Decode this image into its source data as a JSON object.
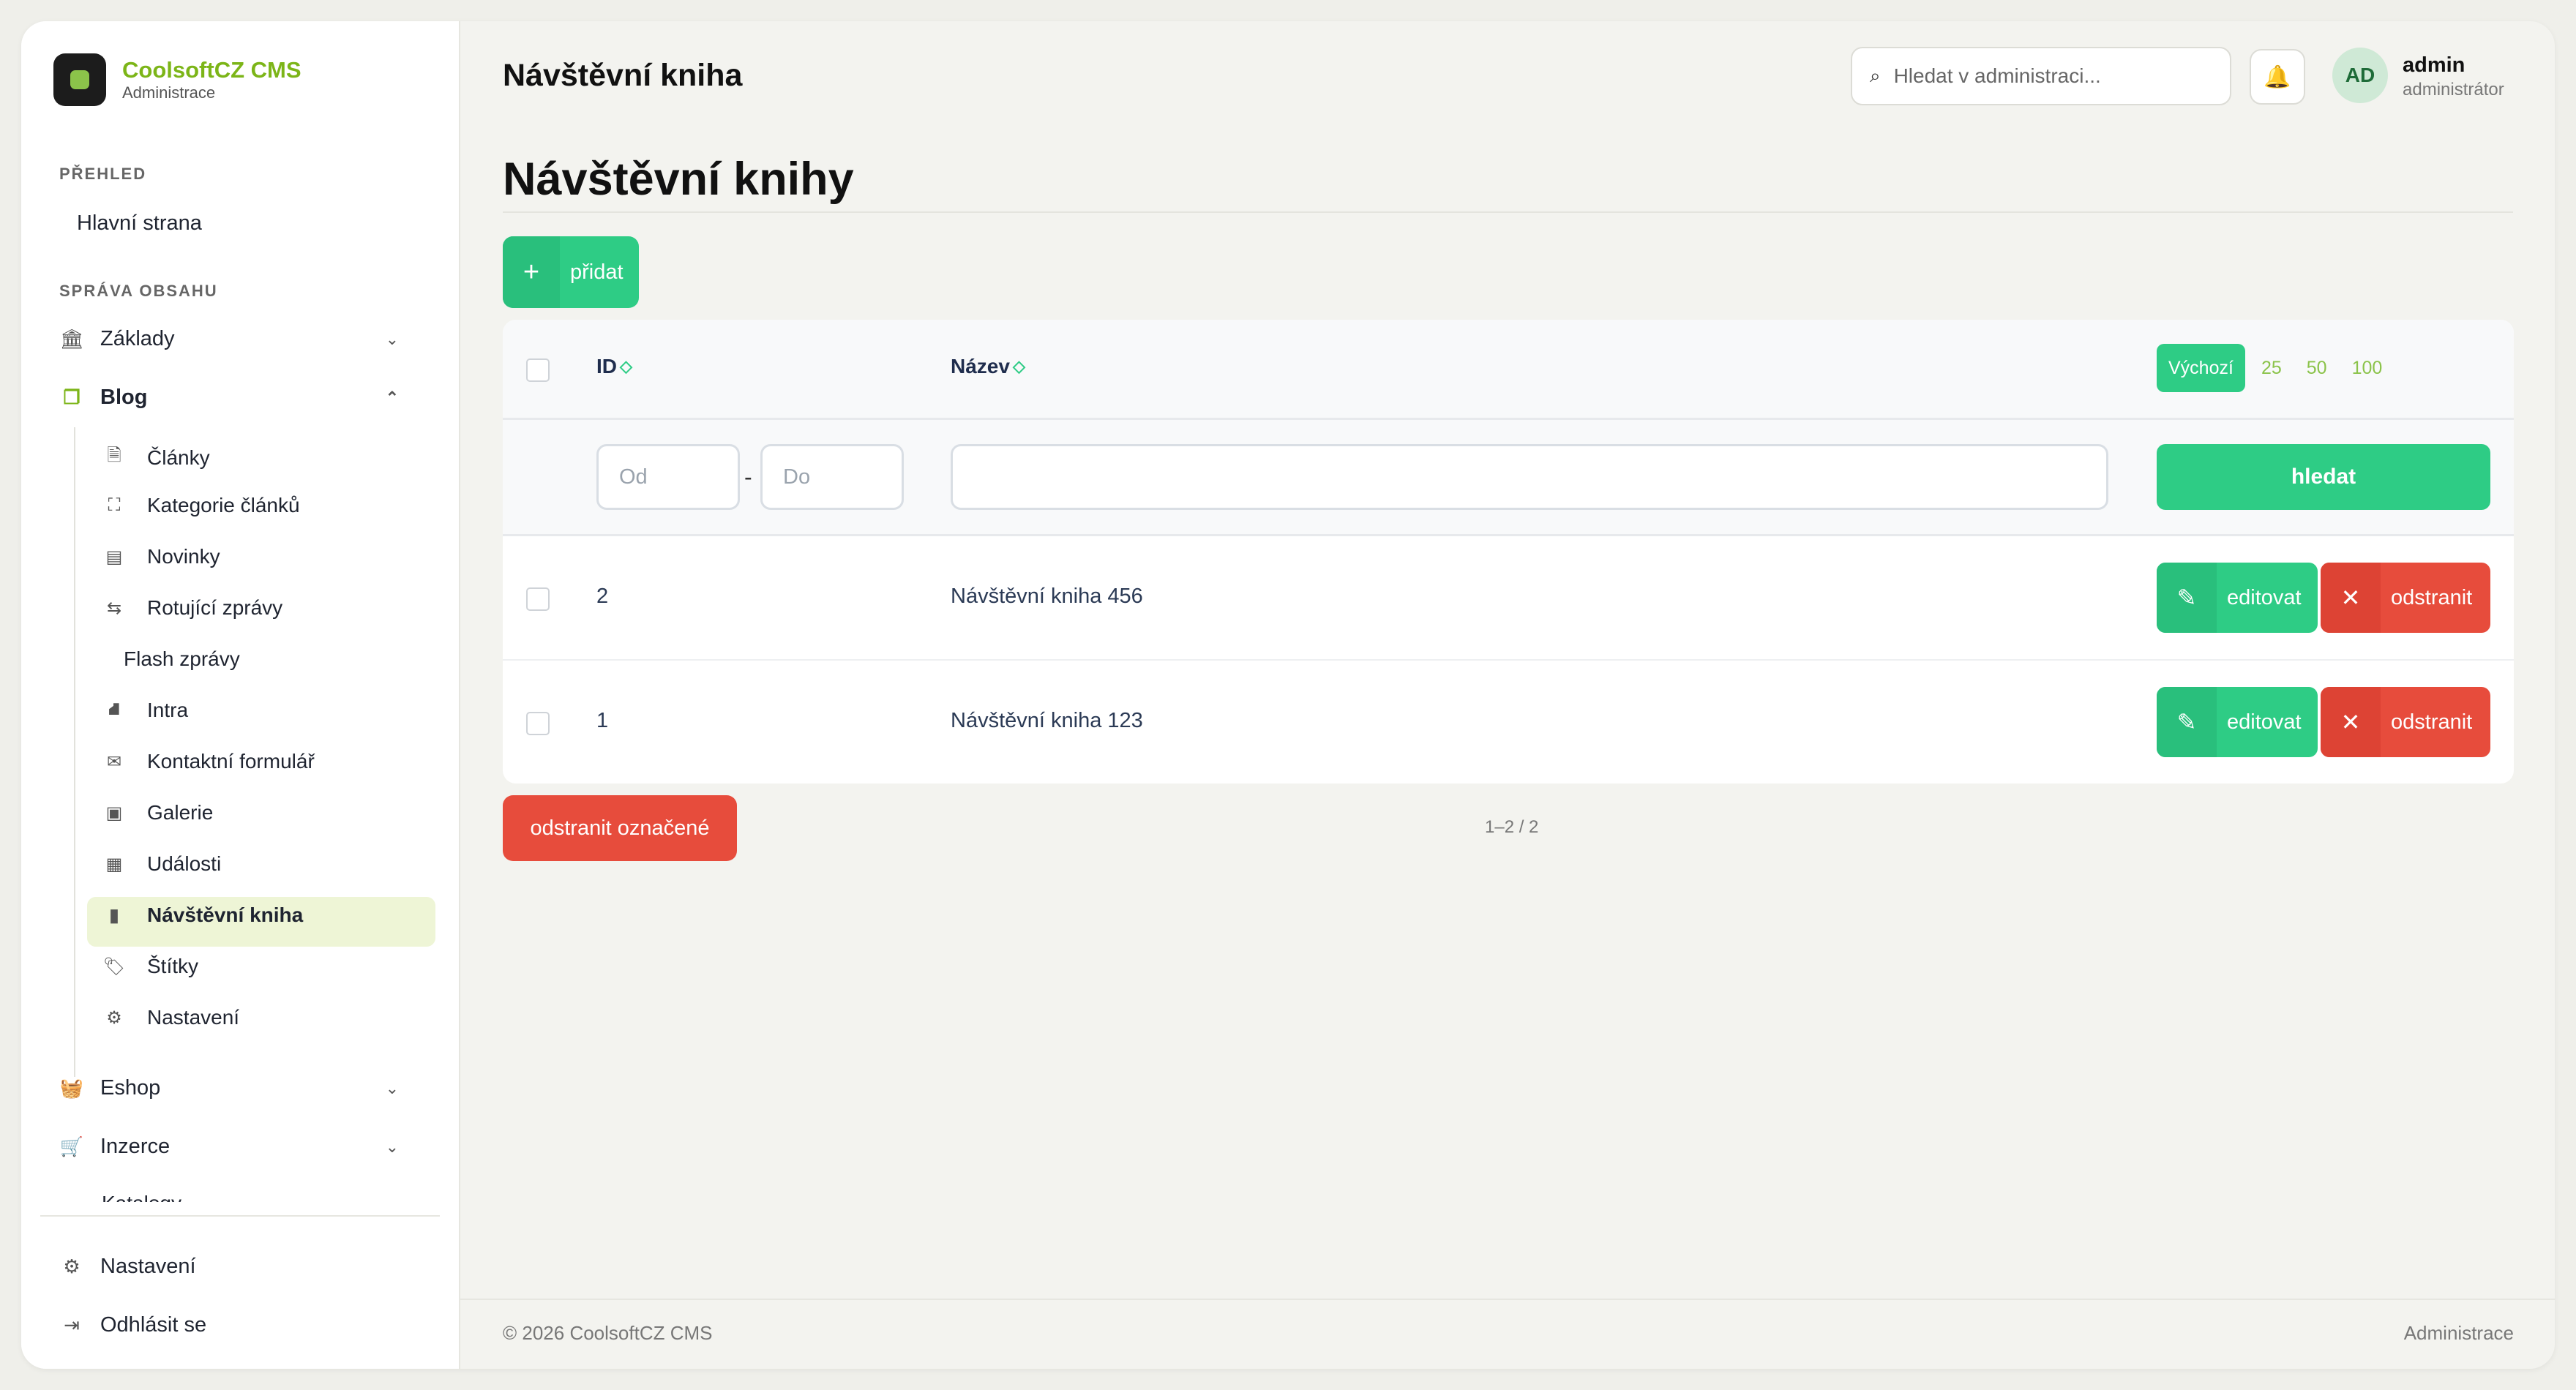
{
  "brand": {
    "name": "CoolsoftCZ CMS",
    "subtitle": "Administrace"
  },
  "sidebar": {
    "section_overview": "PŘEHLED",
    "home": "Hlavní strana",
    "section_content": "SPRÁVA OBSAHU",
    "groups": [
      {
        "label": "Základy",
        "icon": "bank-icon"
      },
      {
        "label": "Blog",
        "icon": "copy-icon"
      }
    ],
    "blog_items": [
      {
        "label": "Články",
        "icon": "file-icon"
      },
      {
        "label": "Kategorie článků",
        "icon": "sitemap-icon"
      },
      {
        "label": "Novinky",
        "icon": "newspaper-icon"
      },
      {
        "label": "Rotující zprávy",
        "icon": "arrows-icon"
      },
      {
        "label": "Flash zprávy",
        "icon": ""
      },
      {
        "label": "Intra",
        "icon": "road-icon"
      },
      {
        "label": "Kontaktní formulář",
        "icon": "envelope-open-icon"
      },
      {
        "label": "Galerie",
        "icon": "images-icon"
      },
      {
        "label": "Události",
        "icon": "calendar-icon"
      },
      {
        "label": "Návštěvní kniha",
        "icon": "book-icon"
      },
      {
        "label": "Štítky",
        "icon": "tags-icon"
      },
      {
        "label": "Nastavení",
        "icon": "gear-icon"
      }
    ],
    "eshop": "Eshop",
    "inzerce": "Inzerce",
    "clipped": "Katalogy",
    "settings": "Nastavení",
    "logout": "Odhlásit se"
  },
  "header": {
    "title": "Návštěvní kniha",
    "search_placeholder": "Hledat v administraci...",
    "avatar_initials": "AD",
    "user_name": "admin",
    "user_role": "administrátor"
  },
  "main": {
    "page_title": "Návštěvní knihy",
    "add_label": "přidat",
    "columns": {
      "id": "ID",
      "name": "Název"
    },
    "per_page": {
      "active": "Výchozí",
      "options": [
        "25",
        "50",
        "100"
      ]
    },
    "filter": {
      "from_placeholder": "Od",
      "to_placeholder": "Do",
      "dash": "-",
      "search_label": "hledat"
    },
    "rows": [
      {
        "id": "2",
        "name": "Návštěvní kniha 456"
      },
      {
        "id": "1",
        "name": "Návštěvní kniha 123"
      }
    ],
    "edit_label": "editovat",
    "delete_label": "odstranit",
    "bulk_delete_label": "odstranit označené",
    "paging": "1–2 / 2"
  },
  "footer": {
    "copyright": "© 2026 CoolsoftCZ CMS",
    "right": "Administrace"
  },
  "colors": {
    "accent": "#2ecc85",
    "danger": "#e74c3c",
    "brand": "#7cb518"
  }
}
